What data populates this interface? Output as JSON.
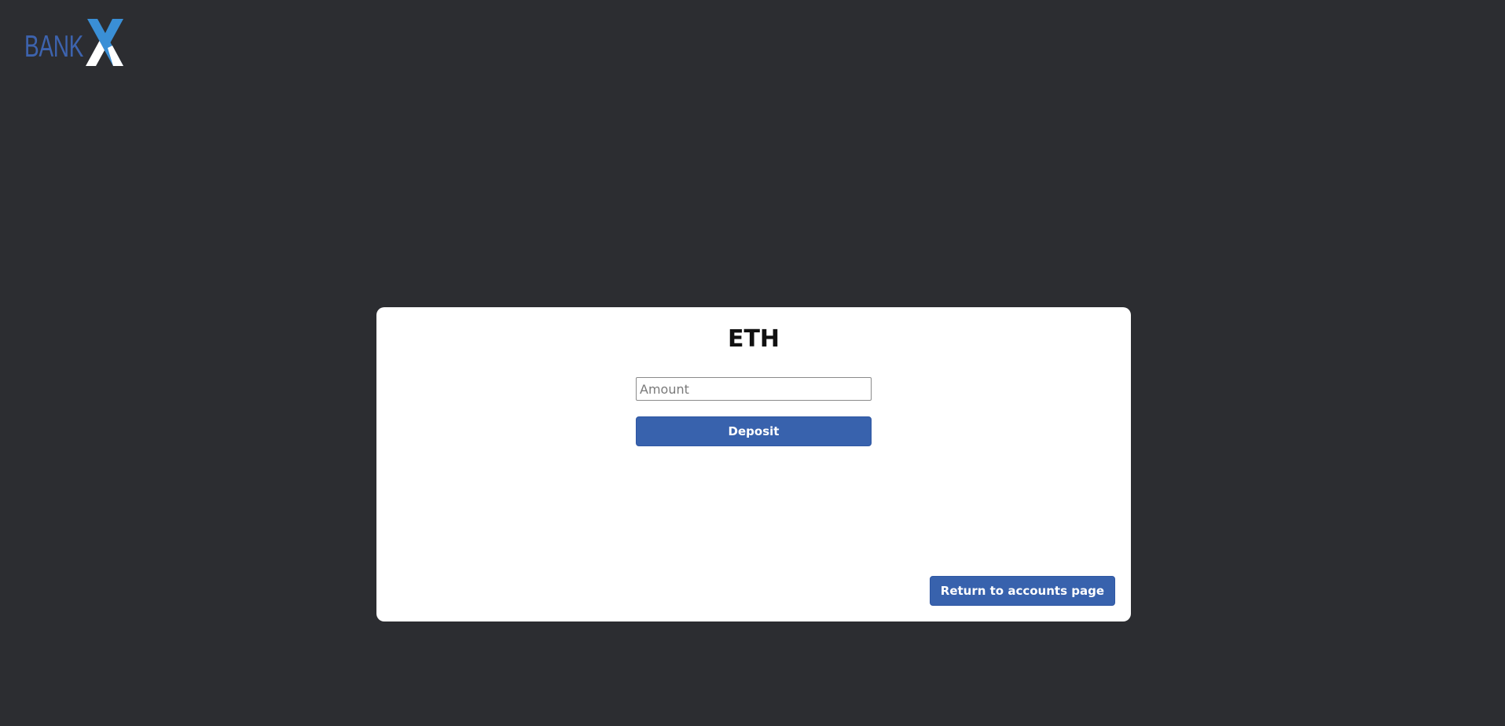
{
  "logo": {
    "bank_text": "BANK",
    "x_text": "X",
    "colors": {
      "text": "#3d63ae",
      "x_left": "#3a8fd6",
      "x_right": "#ffffff"
    }
  },
  "card": {
    "title": "ETH",
    "amount_input": {
      "value": "",
      "placeholder": "Amount"
    },
    "deposit_label": "Deposit",
    "return_label": "Return to accounts page"
  },
  "colors": {
    "background": "#2c2d31",
    "card": "#ffffff",
    "accent": "#3862ad"
  }
}
